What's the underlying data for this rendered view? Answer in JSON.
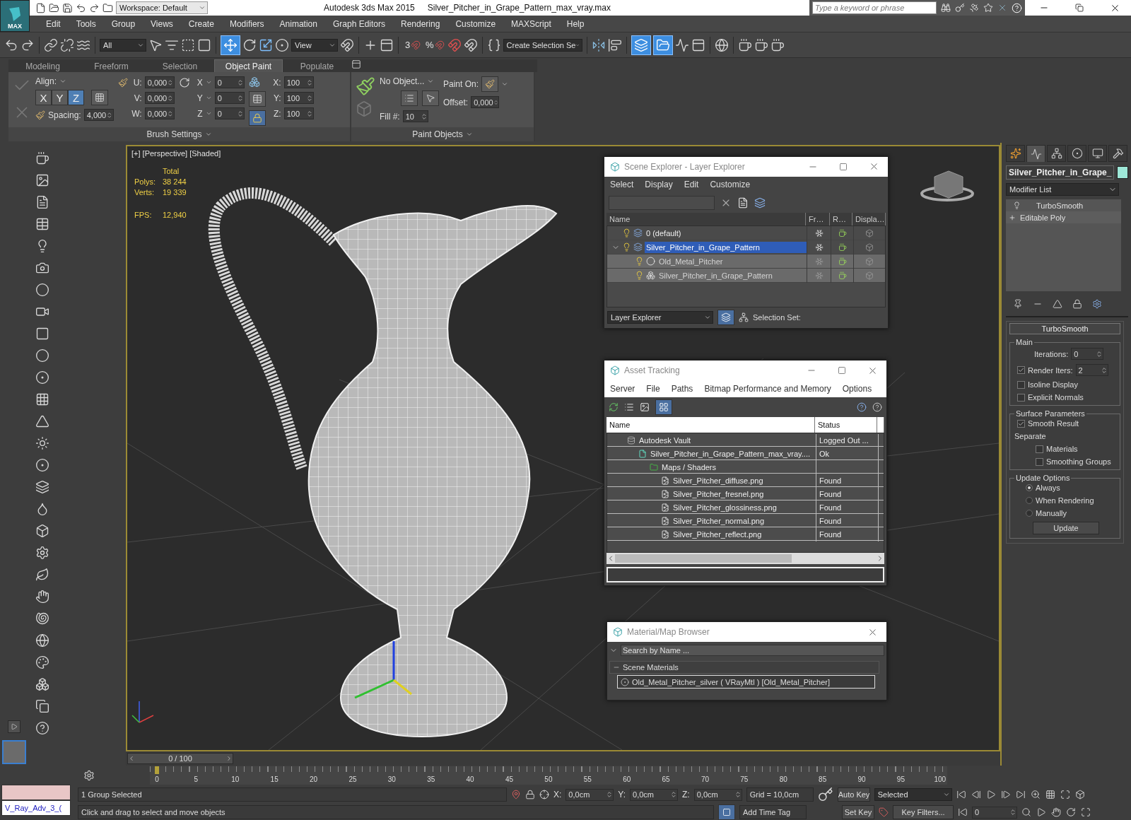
{
  "app": {
    "logo": "MAX",
    "workspace": "Workspace: Default",
    "title": "Autodesk 3ds Max  2015",
    "file": "Silver_Pitcher_in_Grape_Pattern_max_vray.max",
    "search": {
      "placeholder": "Type a keyword or phrase"
    }
  },
  "menu": [
    "Edit",
    "Tools",
    "Group",
    "Views",
    "Create",
    "Modifiers",
    "Animation",
    "Graph Editors",
    "Rendering",
    "Customize",
    "MAXScript",
    "Help"
  ],
  "toolbar": {
    "selection_filter": "All",
    "reference_coord": "View",
    "snap_labels": [
      "3",
      "%"
    ],
    "selection_set": "Create Selection Se"
  },
  "ribbon": {
    "tabs": [
      {
        "label": "Modeling",
        "selected": false
      },
      {
        "label": "Freeform",
        "selected": false
      },
      {
        "label": "Selection",
        "selected": false
      },
      {
        "label": "Object Paint",
        "selected": true
      },
      {
        "label": "Populate",
        "selected": false
      }
    ],
    "align": "Align:",
    "axes": [
      {
        "label": "X",
        "selected": false
      },
      {
        "label": "Y",
        "selected": false
      },
      {
        "label": "Z",
        "selected": true
      }
    ],
    "spacing": {
      "label": "Spacing:",
      "value": "4,000"
    },
    "uvw": [
      {
        "label": "U:",
        "value": "0,000"
      },
      {
        "label": "V:",
        "value": "0,000"
      },
      {
        "label": "W:",
        "value": "0,000"
      }
    ],
    "rotation": [
      {
        "label": "X",
        "value": "0"
      },
      {
        "label": "Y",
        "value": "0"
      },
      {
        "label": "Z",
        "value": "0"
      }
    ],
    "scale": [
      {
        "label": "X:",
        "value": "100"
      },
      {
        "label": "Y:",
        "value": "100"
      },
      {
        "label": "Z:",
        "value": "100"
      }
    ],
    "object": "No Object...",
    "fill": {
      "label": "Fill #:",
      "value": "10"
    },
    "paint_on": "Paint On:",
    "offset": {
      "label": "Offset:",
      "value": "0,000"
    },
    "groups": [
      "Brush Settings",
      "Paint Objects"
    ]
  },
  "viewport": {
    "label": "[+] [Perspective] [Shaded]",
    "stats_header": "Total",
    "stats": [
      {
        "label": "Polys:",
        "value": "38 244"
      },
      {
        "label": "Verts:",
        "value": "19 339"
      }
    ],
    "fps": {
      "label": "FPS:",
      "value": "12,940"
    }
  },
  "scene_explorer": {
    "title": "Scene Explorer - Layer Explorer",
    "menu": [
      "Select",
      "Display",
      "Edit",
      "Customize"
    ],
    "columns": [
      "Name",
      "Fr…",
      "R…",
      "Displa…"
    ],
    "layers": [
      {
        "name": "0 (default)",
        "kind": "layer",
        "selected": false
      },
      {
        "name": "Silver_Pitcher_in_Grape_Pattern",
        "kind": "layer",
        "selected": true,
        "expanded": true,
        "children": [
          {
            "name": "Old_Metal_Pitcher",
            "kind": "object",
            "selected": false
          },
          {
            "name": "Silver_Pitcher_in_Grape_Pattern",
            "kind": "group",
            "selected": false
          }
        ]
      }
    ],
    "mode": "Layer Explorer",
    "selection_set": "Selection Set:"
  },
  "asset_tracking": {
    "title": "Asset Tracking",
    "menu": [
      "Server",
      "File",
      "Paths",
      "Bitmap Performance and Memory",
      "Options"
    ],
    "columns": [
      "Name",
      "Status"
    ],
    "rows": [
      {
        "name": "Autodesk Vault",
        "status": "Logged Out ...",
        "kind": "vault",
        "children": [
          {
            "name": "Silver_Pitcher_in_Grape_Pattern_max_vray....",
            "status": "Ok",
            "kind": "scene",
            "children": [
              {
                "name": "Maps / Shaders",
                "kind": "folder",
                "children": [
                  {
                    "name": "Silver_Pitcher_diffuse.png",
                    "status": "Found",
                    "kind": "bitmap"
                  },
                  {
                    "name": "Silver_Pitcher_fresnel.png",
                    "status": "Found",
                    "kind": "bitmap"
                  },
                  {
                    "name": "Silver_Pitcher_glossiness.png",
                    "status": "Found",
                    "kind": "bitmap"
                  },
                  {
                    "name": "Silver_Pitcher_normal.png",
                    "status": "Found",
                    "kind": "bitmap"
                  },
                  {
                    "name": "Silver_Pitcher_reflect.png",
                    "status": "Found",
                    "kind": "bitmap"
                  }
                ]
              }
            ]
          }
        ]
      }
    ]
  },
  "material_browser": {
    "title": "Material/Map Browser",
    "search": {
      "placeholder": "Search by Name ..."
    },
    "group": "Scene Materials",
    "items": [
      "Old_Metal_Pitcher_silver ( VRayMtl ) [Old_Metal_Pitcher]"
    ]
  },
  "command_panel": {
    "tabs": [
      {
        "selected": false
      },
      {
        "selected": true
      },
      {
        "selected": false
      },
      {
        "selected": false
      },
      {
        "selected": false
      },
      {
        "selected": false
      }
    ],
    "object_name": "Silver_Pitcher_in_Grape_",
    "modifier_list": "Modifier List",
    "stack": [
      {
        "name": "TurboSmooth",
        "kind": "modifier"
      },
      {
        "name": "Editable Poly",
        "kind": "base"
      }
    ],
    "rollout": {
      "title": "TurboSmooth",
      "main": {
        "title": "Main",
        "iterations": {
          "label": "Iterations:",
          "value": "0"
        },
        "render_iters": {
          "label": "Render Iters:",
          "value": "2",
          "checked": true
        },
        "options": [
          {
            "label": "Isoline Display",
            "checked": false
          },
          {
            "label": "Explicit Normals",
            "checked": false
          }
        ]
      },
      "surface": {
        "title": "Surface Parameters",
        "smooth_result": {
          "label": "Smooth Result",
          "checked": true
        },
        "separate_label": "Separate",
        "separate": [
          {
            "label": "Materials",
            "checked": false
          },
          {
            "label": "Smoothing Groups",
            "checked": false
          }
        ]
      },
      "update": {
        "title": "Update Options",
        "options": [
          {
            "label": "Always",
            "selected": true
          },
          {
            "label": "When Rendering",
            "selected": false
          },
          {
            "label": "Manually",
            "selected": false
          }
        ],
        "button": "Update"
      }
    }
  },
  "timeline": {
    "frame": "0 / 100",
    "level": 0,
    "ticks": [
      "0",
      "5",
      "10",
      "15",
      "20",
      "25",
      "30",
      "35",
      "40",
      "45",
      "50",
      "55",
      "60",
      "65",
      "70",
      "75",
      "80",
      "85",
      "90",
      "95",
      "100"
    ]
  },
  "status": {
    "script": "V_Ray_Adv_3_(",
    "selection": "1 Group Selected",
    "prompt": "Click and drag to select and move objects",
    "coords": [
      {
        "label": "X:",
        "value": "0,0cm"
      },
      {
        "label": "Y:",
        "value": "0,0cm"
      },
      {
        "label": "Z:",
        "value": "0,0cm"
      }
    ],
    "grid": "Grid = 10,0cm",
    "add_time_tag": "Add Time Tag",
    "auto_key": "Auto Key",
    "set_key": "Set Key",
    "key_mode": "Selected",
    "key_filters": "Key Filters...",
    "frame": "0"
  }
}
